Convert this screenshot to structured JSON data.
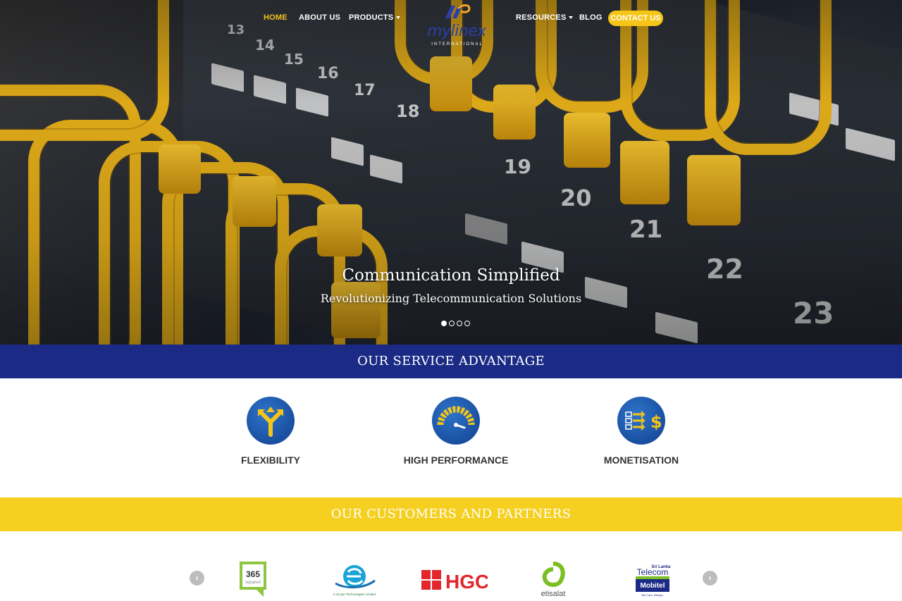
{
  "nav": {
    "home": "HOME",
    "about": "ABOUT US",
    "products": "PRODUCTS",
    "resources": "RESOURCES",
    "blog": "BLOG",
    "contact": "CONTACT US"
  },
  "logo": {
    "word": "mylinex",
    "sub": "INTERNATIONAL"
  },
  "hero": {
    "title": "Communication Simplified",
    "subtitle": "Revolutionizing Telecommunication Solutions",
    "slide_count": 4,
    "active_slide": 1,
    "port_numbers": [
      "13",
      "14",
      "15",
      "16",
      "17",
      "18",
      "19",
      "20",
      "21",
      "22",
      "23"
    ]
  },
  "services": {
    "title": "OUR SERVICE ADVANTAGE",
    "items": [
      {
        "label": "FLEXIBILITY",
        "icon": "split-arrows-icon"
      },
      {
        "label": "HIGH PERFORMANCE",
        "icon": "speedometer-icon"
      },
      {
        "label": "MONETISATION",
        "icon": "dollar-arrows-icon"
      }
    ]
  },
  "partners": {
    "title": "OUR CUSTOMERS AND PARTNERS",
    "logos": {
      "p365": "365",
      "p365_sub": "squared",
      "escope": "e-Scope Technologies Limited",
      "hgc": "HGC",
      "etisalat": "etisalat",
      "sl_top": "Sri Lanka",
      "sl_telecom": "Telecom",
      "mobitel": "Mobitel",
      "mobitel_tag": "We Care. Always."
    }
  },
  "colors": {
    "accent_yellow": "#f5c518",
    "band_blue": "#1a2a85",
    "band_yellow": "#f5d020",
    "icon_blue": "#1a4fa0"
  }
}
